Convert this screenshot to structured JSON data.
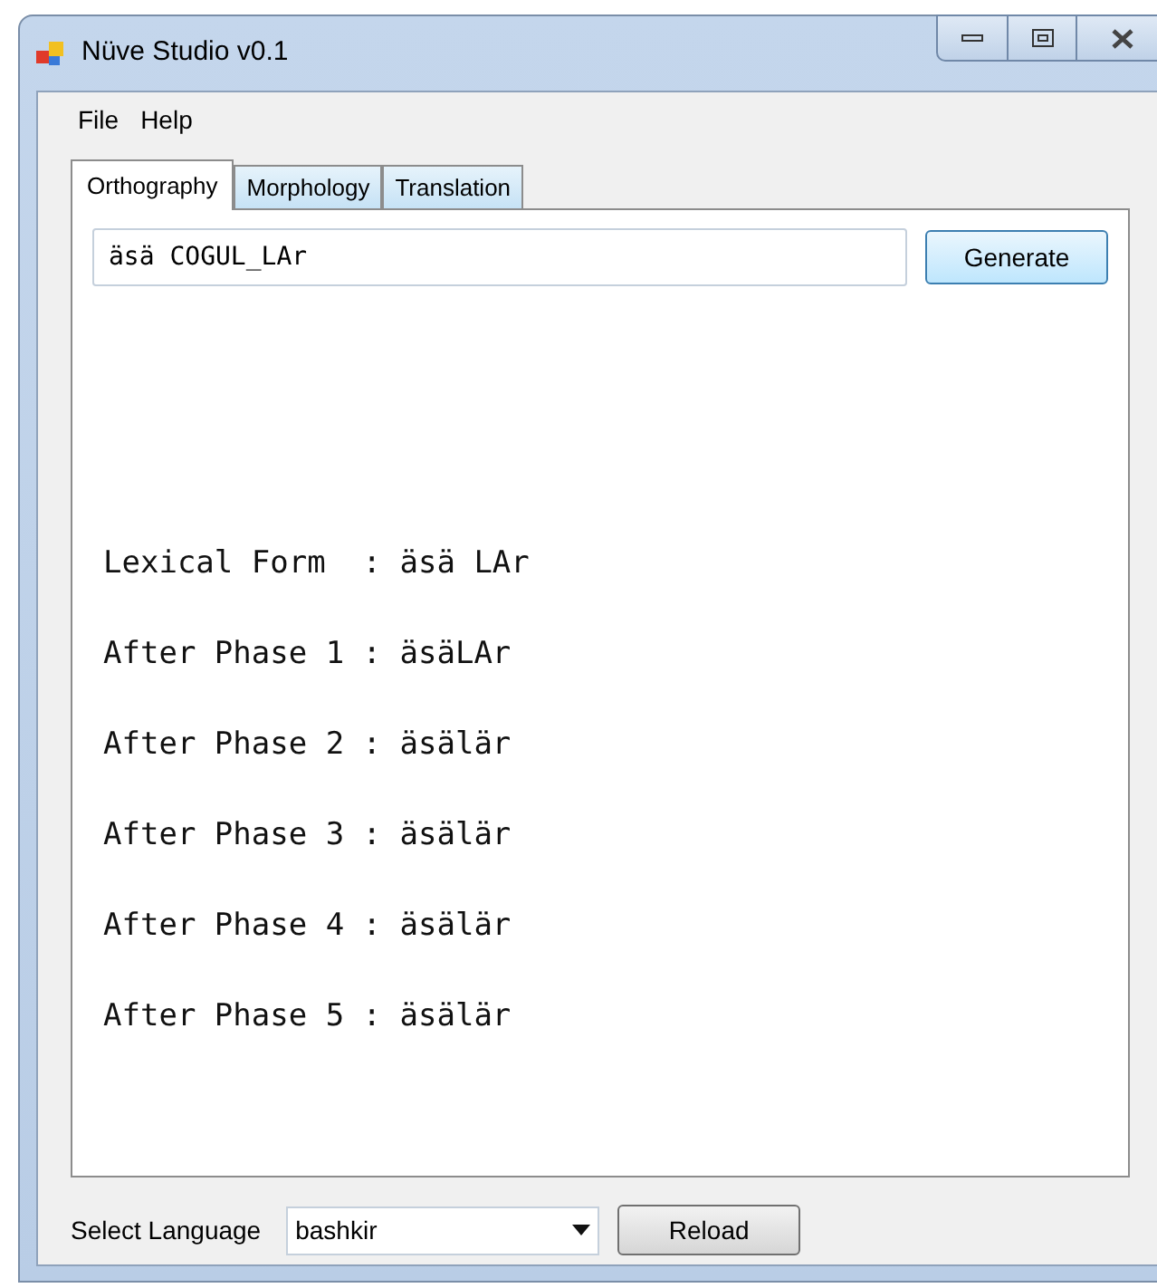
{
  "window": {
    "title": "Nüve Studio v0.1"
  },
  "menu": [
    "File",
    "Help"
  ],
  "tabs": [
    {
      "label": "Orthography",
      "selected": true
    },
    {
      "label": "Morphology",
      "selected": false
    },
    {
      "label": "Translation",
      "selected": false
    }
  ],
  "input": {
    "value": "äsä COGUL_LAr"
  },
  "generate_button": "Generate",
  "output_lines": [
    "Lexical Form  : äsä LAr",
    "After Phase 1 : äsäLAr",
    "After Phase 2 : äsälär",
    "After Phase 3 : äsälär",
    "After Phase 4 : äsälär",
    "After Phase 5 : äsälär"
  ],
  "footer": {
    "label": "Select Language",
    "language": "bashkir",
    "reload_button": "Reload"
  }
}
